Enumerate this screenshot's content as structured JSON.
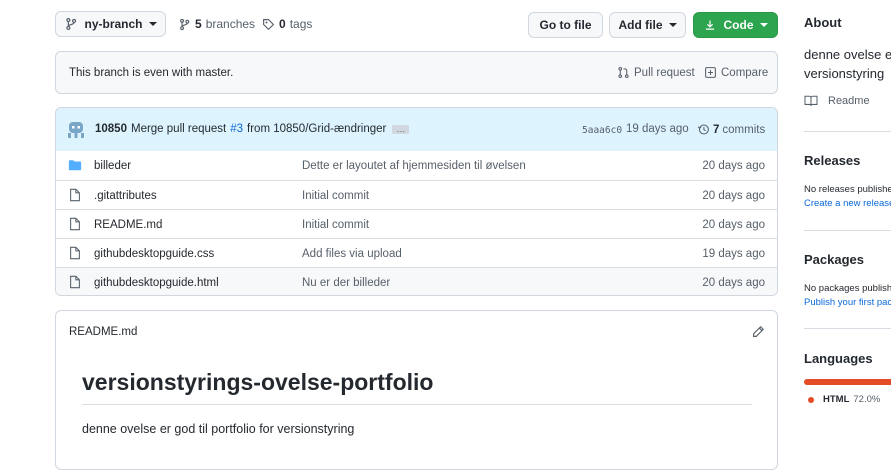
{
  "toolbar": {
    "branch_label": "ny-branch",
    "branches_count": "5",
    "branches_label": "branches",
    "tags_count": "0",
    "tags_label": "tags",
    "go_to_file": "Go to file",
    "add_file": "Add file",
    "code": "Code"
  },
  "branch_status": {
    "message": "This branch is even with master.",
    "pull_request": "Pull request",
    "compare": "Compare"
  },
  "commit": {
    "author": "10850",
    "message_prefix": "Merge pull request",
    "pr_ref": "#3",
    "message_suffix": "from 10850/Grid-ændringer",
    "ellipsis": "…",
    "sha": "5aaa6c0",
    "age": "19 days ago",
    "commits_count": "7",
    "commits_label": "commits"
  },
  "files": [
    {
      "name": "billeder",
      "type": "folder",
      "message": "Dette er layoutet af hjemmesiden til øvelsen",
      "age": "20 days ago"
    },
    {
      "name": ".gitattributes",
      "type": "file",
      "message": "Initial commit",
      "age": "20 days ago"
    },
    {
      "name": "README.md",
      "type": "file",
      "message": "Initial commit",
      "age": "20 days ago"
    },
    {
      "name": "githubdesktopguide.css",
      "type": "file",
      "message": "Add files via upload",
      "age": "19 days ago"
    },
    {
      "name": "githubdesktopguide.html",
      "type": "file",
      "message": "Nu er der billeder",
      "age": "20 days ago"
    }
  ],
  "readme": {
    "filename": "README.md",
    "heading": "versionstyrings-ovelse-portfolio",
    "body": "denne ovelse er god til portfolio for versionstyring"
  },
  "sidebar": {
    "about_title": "About",
    "about_text_1": "denne ovelse er",
    "about_text_2": "versionstyring",
    "readme_link": "Readme",
    "releases_title": "Releases",
    "releases_text": "No releases published",
    "releases_link": "Create a new release",
    "packages_title": "Packages",
    "packages_text": "No packages published",
    "packages_link": "Publish your first package",
    "languages_title": "Languages",
    "language_name": "HTML",
    "language_percent": "72.0%",
    "language_fraction": 0.72
  },
  "colors": {
    "accent": "#0969da",
    "green": "#2da44e",
    "html_lang": "#e34c26",
    "folder": "#54aeff",
    "avatar": "#7aa6c8"
  }
}
